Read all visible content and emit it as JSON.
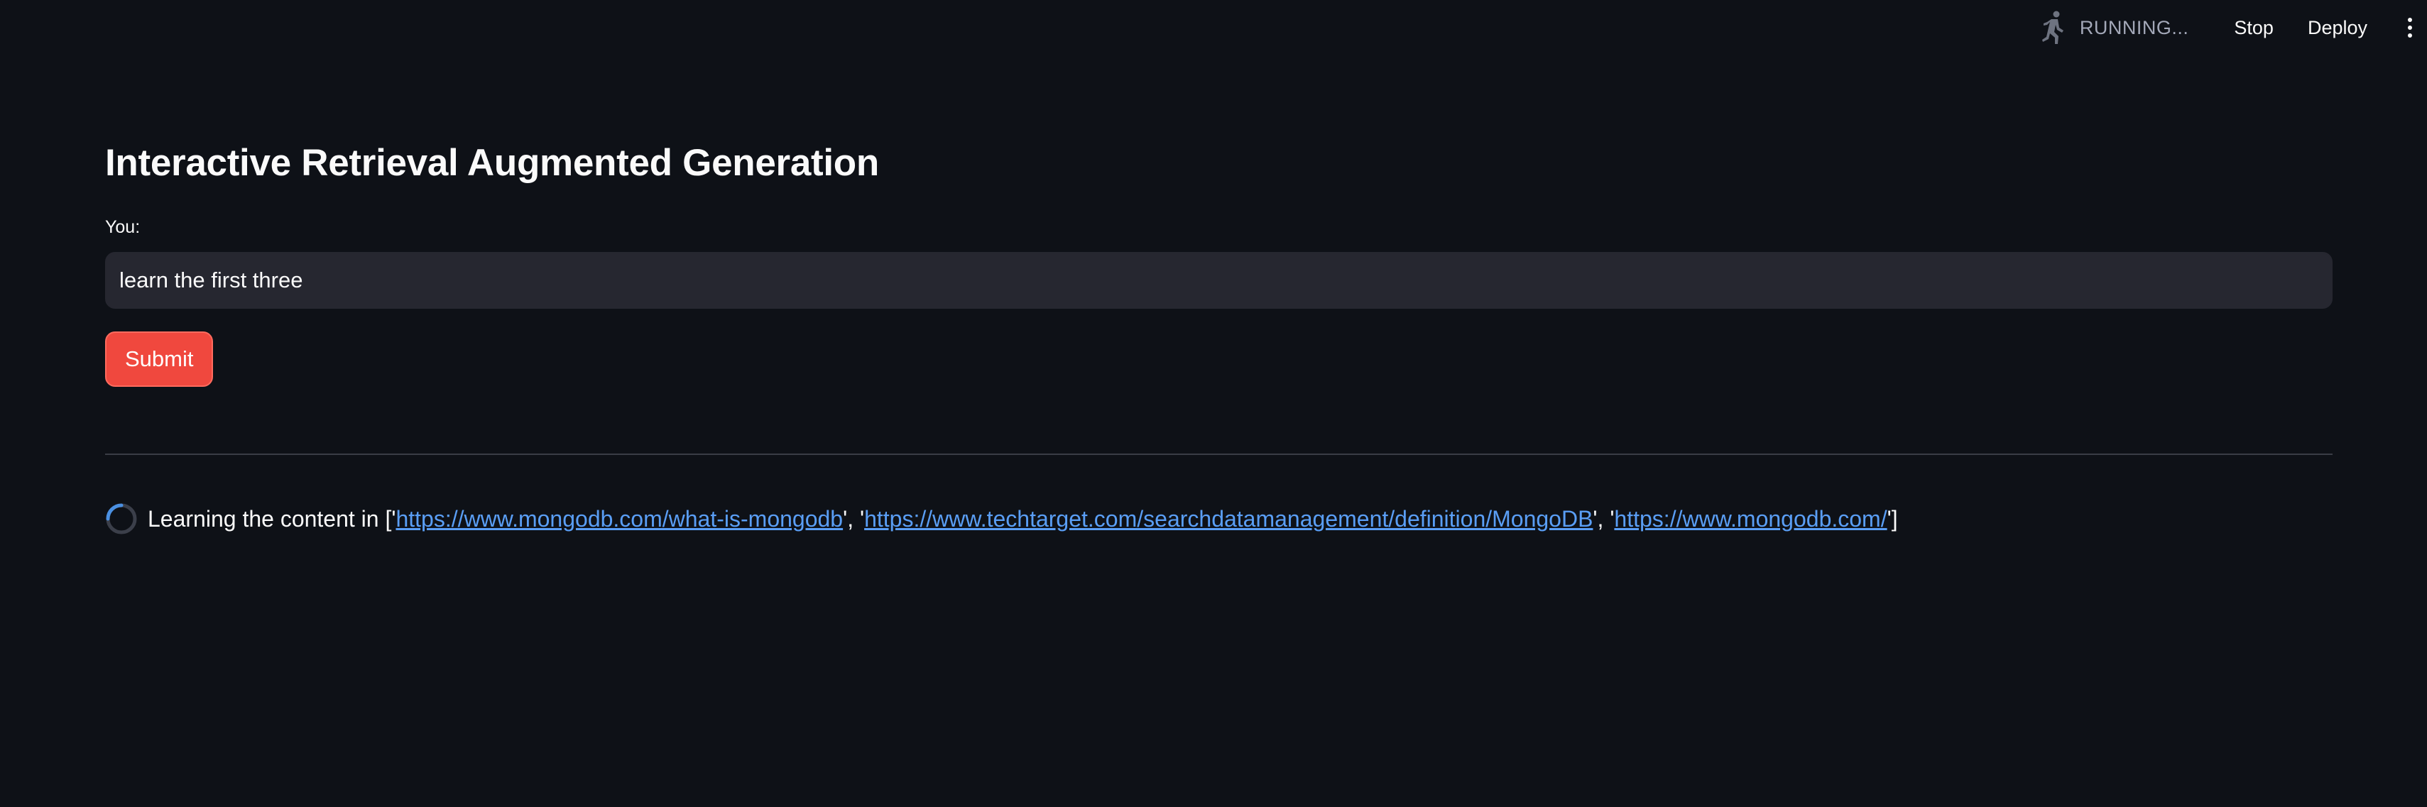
{
  "toolbar": {
    "status_text": "RUNNING...",
    "stop_label": "Stop",
    "deploy_label": "Deploy",
    "icons": {
      "running": "running-man-icon",
      "menu": "vertical-dots-icon"
    }
  },
  "main": {
    "title": "Interactive Retrieval Augmented Generation",
    "input_label": "You:",
    "input_value": "learn the first three",
    "submit_label": "Submit"
  },
  "status": {
    "prefix": "Learning the content in ['",
    "links": [
      "https://www.mongodb.com/what-is-mongodb",
      "https://www.techtarget.com/searchdatamanagement/definition/MongoDB",
      "https://www.mongodb.com/"
    ],
    "separator_1": "', '",
    "separator_2": "', '",
    "suffix": "']"
  },
  "colors": {
    "background": "#0e1117",
    "input_background": "#262730",
    "primary_button": "#f0483e",
    "link": "#5a9ef5",
    "spinner": "#4a90e2"
  }
}
